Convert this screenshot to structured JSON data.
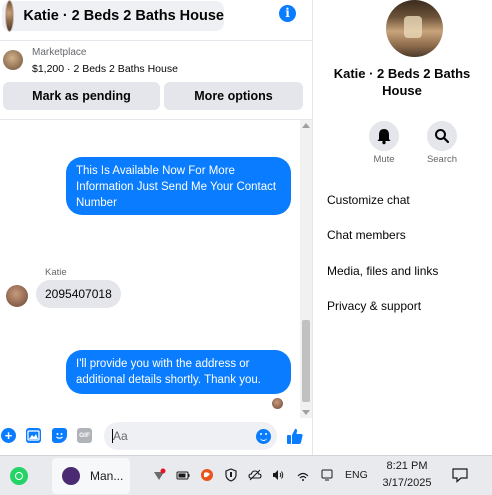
{
  "header": {
    "title": "Katie · 2 Beds 2 Baths House",
    "info_icon": "info-icon"
  },
  "marketplace": {
    "label": "Marketplace",
    "listing": "$1,200 · 2 Beds 2 Baths House",
    "mark_pending_label": "Mark as pending",
    "more_options_label": "More options"
  },
  "messages": [
    {
      "direction": "outgoing",
      "text": "This Is Available Now For More Information Just Send Me Your Contact Number"
    },
    {
      "direction": "incoming",
      "sender": "Katie",
      "text": "2095407018"
    },
    {
      "direction": "outgoing",
      "text": "I'll provide you with the address or additional details shortly. Thank you."
    }
  ],
  "composer": {
    "placeholder": "Aa",
    "icons": [
      "plus-icon",
      "photo-icon",
      "sticker-icon",
      "gif-icon",
      "emoji-icon",
      "like-icon"
    ],
    "gif_label": "GIF"
  },
  "info_panel": {
    "name": "Katie · 2 Beds 2 Baths House",
    "actions": [
      {
        "label": "Mute",
        "icon": "bell-icon"
      },
      {
        "label": "Search",
        "icon": "search-icon"
      }
    ],
    "menu": [
      "Customize chat",
      "Chat members",
      "Media, files and links",
      "Privacy & support"
    ]
  },
  "taskbar": {
    "app_label": "Man...",
    "language": "ENG",
    "time": "8:21 PM",
    "date": "3/17/2025"
  },
  "colors": {
    "accent": "#0a7cff",
    "bubble_in": "#e4e6eb",
    "whatsapp": "#25d366"
  }
}
